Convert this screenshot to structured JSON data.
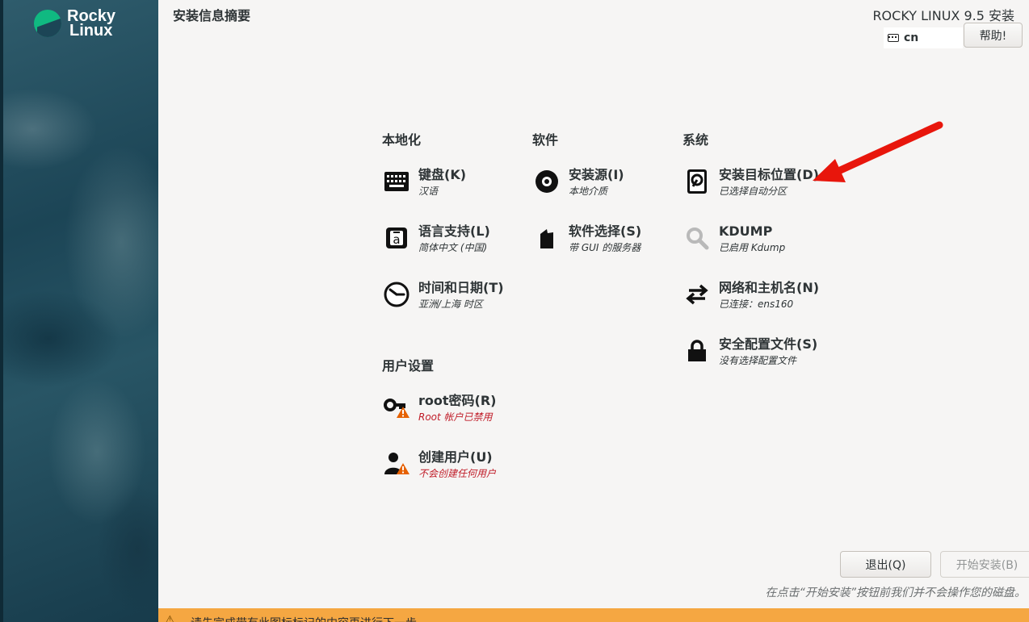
{
  "sidebar": {
    "logo_line1": "Rocky",
    "logo_line2": "Linux"
  },
  "header": {
    "title": "安装信息摘要",
    "product": "ROCKY LINUX 9.5 安装",
    "keyboard_layout": "cn",
    "help_label": "帮助!"
  },
  "sections": {
    "localization": "本地化",
    "software": "软件",
    "system": "系统",
    "user_settings": "用户设置"
  },
  "spokes": {
    "keyboard": {
      "label": "键盘(K)",
      "status": "汉语",
      "icon": "keyboard-icon"
    },
    "language": {
      "label": "语言支持(L)",
      "status": "简体中文 (中国)",
      "icon": "language-icon"
    },
    "time": {
      "label": "时间和日期(T)",
      "status": "亚洲/上海 时区",
      "icon": "clock-icon"
    },
    "source": {
      "label": "安装源(I)",
      "status": "本地介质",
      "icon": "disc-icon"
    },
    "software_selection": {
      "label": "软件选择(S)",
      "status": "带 GUI 的服务器",
      "icon": "package-icon"
    },
    "destination": {
      "label": "安装目标位置(D)",
      "status": "已选择自动分区",
      "icon": "harddisk-icon"
    },
    "kdump": {
      "label": "KDUMP",
      "status": "已启用 Kdump",
      "icon": "magnifier-icon"
    },
    "network": {
      "label": "网络和主机名(N)",
      "status": "已连接：ens160",
      "icon": "network-arrows-icon"
    },
    "security": {
      "label": "安全配置文件(S)",
      "status": "没有选择配置文件",
      "icon": "lock-icon"
    },
    "root": {
      "label": "root密码(R)",
      "status": "Root 帐户已禁用",
      "icon": "key-warning-icon"
    },
    "user": {
      "label": "创建用户(U)",
      "status": "不会创建任何用户",
      "icon": "user-warning-icon"
    }
  },
  "footer": {
    "quit_label": "退出(Q)",
    "begin_label": "开始安装(B)",
    "note": "在点击“开始安装”按钮前我们并不会操作您的磁盘。",
    "warning": "请先完成带有此图标标记的内容再进行下一步。"
  },
  "colors": {
    "warning_text": "#c01c28",
    "warning_bar": "#f5a742",
    "annotation_arrow": "#e8160c"
  }
}
